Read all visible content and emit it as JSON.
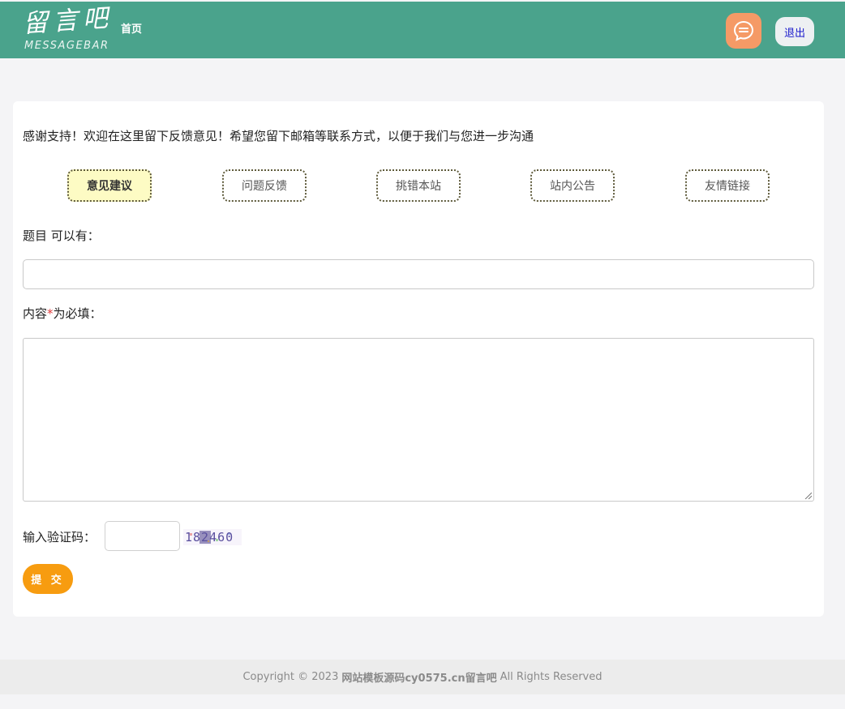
{
  "header": {
    "logo_cn": "留言吧",
    "logo_en": "MESSAGEBAR",
    "home_link": "首页",
    "message_icon": "chat-bubble-icon",
    "logout_label": "退出",
    "colors": {
      "bar": "#4aa38c",
      "message_button": "#f59a66"
    }
  },
  "form": {
    "intro": "感谢支持！欢迎在这里留下反馈意见！希望您留下邮箱等联系方式，以便于我们与您进一步沟通",
    "tabs": [
      {
        "label": "意见建议",
        "active": true
      },
      {
        "label": "问题反馈",
        "active": false
      },
      {
        "label": "挑错本站",
        "active": false
      },
      {
        "label": "站内公告",
        "active": false
      },
      {
        "label": "友情链接",
        "active": false
      }
    ],
    "title_label": "题目 可以有：",
    "title_value": "",
    "content_label_prefix": "内容",
    "content_required_mark": "*",
    "content_label_suffix": "为必填：",
    "content_value": "",
    "captcha_label": "输入验证码：",
    "captcha_value": "",
    "captcha_code": "182460",
    "submit_label": "提 交",
    "colors": {
      "submit": "#f79c10",
      "active_tab": "#fdfbc4",
      "required": "#e03a3a"
    }
  },
  "footer": {
    "copyright_prefix": "Copyright © 2023",
    "site_name": "网站模板源码cy0575.cn留言吧",
    "copyright_suffix": "All Rights Reserved"
  }
}
